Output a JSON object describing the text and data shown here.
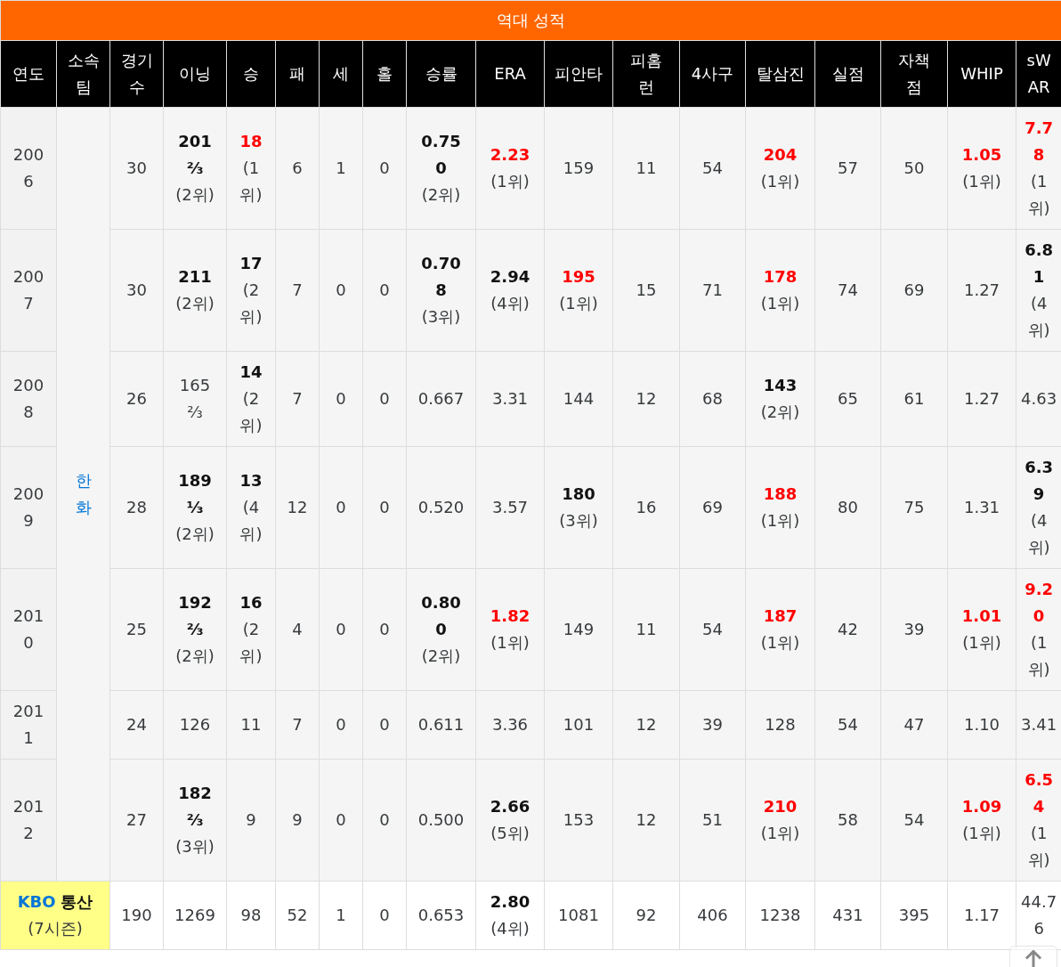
{
  "title": "역대 성적",
  "columns": [
    "연도",
    "소속팀",
    "경기수",
    "이닝",
    "승",
    "패",
    "세",
    "홀",
    "승률",
    "ERA",
    "피안타",
    "피홈런",
    "4사구",
    "탈삼진",
    "실점",
    "자책점",
    "WHIP",
    "sWAR"
  ],
  "team": "한화",
  "rows": [
    {
      "year": "2006",
      "cells": [
        {
          "value": "30",
          "kind": "plain"
        },
        {
          "value": "201⅔",
          "rank": "(2위)",
          "kind": "bold"
        },
        {
          "value": "18",
          "rank": "(1위)",
          "kind": "red"
        },
        {
          "value": "6",
          "kind": "plain"
        },
        {
          "value": "1",
          "kind": "plain"
        },
        {
          "value": "0",
          "kind": "plain"
        },
        {
          "value": "0.750",
          "rank": "(2위)",
          "kind": "bold"
        },
        {
          "value": "2.23",
          "rank": "(1위)",
          "kind": "red"
        },
        {
          "value": "159",
          "kind": "plain"
        },
        {
          "value": "11",
          "kind": "plain"
        },
        {
          "value": "54",
          "kind": "plain"
        },
        {
          "value": "204",
          "rank": "(1위)",
          "kind": "red"
        },
        {
          "value": "57",
          "kind": "plain"
        },
        {
          "value": "50",
          "kind": "plain"
        },
        {
          "value": "1.05",
          "rank": "(1위)",
          "kind": "red"
        },
        {
          "value": "7.78",
          "rank": "(1위)",
          "kind": "red"
        }
      ]
    },
    {
      "year": "2007",
      "cells": [
        {
          "value": "30",
          "kind": "plain"
        },
        {
          "value": "211",
          "rank": "(2위)",
          "kind": "bold"
        },
        {
          "value": "17",
          "rank": "(2위)",
          "kind": "bold"
        },
        {
          "value": "7",
          "kind": "plain"
        },
        {
          "value": "0",
          "kind": "plain"
        },
        {
          "value": "0",
          "kind": "plain"
        },
        {
          "value": "0.708",
          "rank": "(3위)",
          "kind": "bold"
        },
        {
          "value": "2.94",
          "rank": "(4위)",
          "kind": "bold"
        },
        {
          "value": "195",
          "rank": "(1위)",
          "kind": "red"
        },
        {
          "value": "15",
          "kind": "plain"
        },
        {
          "value": "71",
          "kind": "plain"
        },
        {
          "value": "178",
          "rank": "(1위)",
          "kind": "red"
        },
        {
          "value": "74",
          "kind": "plain"
        },
        {
          "value": "69",
          "kind": "plain"
        },
        {
          "value": "1.27",
          "kind": "plain"
        },
        {
          "value": "6.81",
          "rank": "(4위)",
          "kind": "bold"
        }
      ]
    },
    {
      "year": "2008",
      "cells": [
        {
          "value": "26",
          "kind": "plain"
        },
        {
          "value": "165⅔",
          "kind": "plain"
        },
        {
          "value": "14",
          "rank": "(2위)",
          "kind": "bold"
        },
        {
          "value": "7",
          "kind": "plain"
        },
        {
          "value": "0",
          "kind": "plain"
        },
        {
          "value": "0",
          "kind": "plain"
        },
        {
          "value": "0.667",
          "kind": "plain"
        },
        {
          "value": "3.31",
          "kind": "plain"
        },
        {
          "value": "144",
          "kind": "plain"
        },
        {
          "value": "12",
          "kind": "plain"
        },
        {
          "value": "68",
          "kind": "plain"
        },
        {
          "value": "143",
          "rank": "(2위)",
          "kind": "bold"
        },
        {
          "value": "65",
          "kind": "plain"
        },
        {
          "value": "61",
          "kind": "plain"
        },
        {
          "value": "1.27",
          "kind": "plain"
        },
        {
          "value": "4.63",
          "kind": "plain"
        }
      ]
    },
    {
      "year": "2009",
      "cells": [
        {
          "value": "28",
          "kind": "plain"
        },
        {
          "value": "189⅓",
          "rank": "(2위)",
          "kind": "bold"
        },
        {
          "value": "13",
          "rank": "(4위)",
          "kind": "bold"
        },
        {
          "value": "12",
          "kind": "plain"
        },
        {
          "value": "0",
          "kind": "plain"
        },
        {
          "value": "0",
          "kind": "plain"
        },
        {
          "value": "0.520",
          "kind": "plain"
        },
        {
          "value": "3.57",
          "kind": "plain"
        },
        {
          "value": "180",
          "rank": "(3위)",
          "kind": "bold"
        },
        {
          "value": "16",
          "kind": "plain"
        },
        {
          "value": "69",
          "kind": "plain"
        },
        {
          "value": "188",
          "rank": "(1위)",
          "kind": "red"
        },
        {
          "value": "80",
          "kind": "plain"
        },
        {
          "value": "75",
          "kind": "plain"
        },
        {
          "value": "1.31",
          "kind": "plain"
        },
        {
          "value": "6.39",
          "rank": "(4위)",
          "kind": "bold"
        }
      ]
    },
    {
      "year": "2010",
      "cells": [
        {
          "value": "25",
          "kind": "plain"
        },
        {
          "value": "192⅔",
          "rank": "(2위)",
          "kind": "bold"
        },
        {
          "value": "16",
          "rank": "(2위)",
          "kind": "bold"
        },
        {
          "value": "4",
          "kind": "plain"
        },
        {
          "value": "0",
          "kind": "plain"
        },
        {
          "value": "0",
          "kind": "plain"
        },
        {
          "value": "0.800",
          "rank": "(2위)",
          "kind": "bold"
        },
        {
          "value": "1.82",
          "rank": "(1위)",
          "kind": "red"
        },
        {
          "value": "149",
          "kind": "plain"
        },
        {
          "value": "11",
          "kind": "plain"
        },
        {
          "value": "54",
          "kind": "plain"
        },
        {
          "value": "187",
          "rank": "(1위)",
          "kind": "red"
        },
        {
          "value": "42",
          "kind": "plain"
        },
        {
          "value": "39",
          "kind": "plain"
        },
        {
          "value": "1.01",
          "rank": "(1위)",
          "kind": "red"
        },
        {
          "value": "9.20",
          "rank": "(1위)",
          "kind": "red"
        }
      ]
    },
    {
      "year": "2011",
      "cells": [
        {
          "value": "24",
          "kind": "plain"
        },
        {
          "value": "126",
          "kind": "plain"
        },
        {
          "value": "11",
          "kind": "plain"
        },
        {
          "value": "7",
          "kind": "plain"
        },
        {
          "value": "0",
          "kind": "plain"
        },
        {
          "value": "0",
          "kind": "plain"
        },
        {
          "value": "0.611",
          "kind": "plain"
        },
        {
          "value": "3.36",
          "kind": "plain"
        },
        {
          "value": "101",
          "kind": "plain"
        },
        {
          "value": "12",
          "kind": "plain"
        },
        {
          "value": "39",
          "kind": "plain"
        },
        {
          "value": "128",
          "kind": "plain"
        },
        {
          "value": "54",
          "kind": "plain"
        },
        {
          "value": "47",
          "kind": "plain"
        },
        {
          "value": "1.10",
          "kind": "plain"
        },
        {
          "value": "3.41",
          "kind": "plain"
        }
      ]
    },
    {
      "year": "2012",
      "cells": [
        {
          "value": "27",
          "kind": "plain"
        },
        {
          "value": "182⅔",
          "rank": "(3위)",
          "kind": "bold"
        },
        {
          "value": "9",
          "kind": "plain"
        },
        {
          "value": "9",
          "kind": "plain"
        },
        {
          "value": "0",
          "kind": "plain"
        },
        {
          "value": "0",
          "kind": "plain"
        },
        {
          "value": "0.500",
          "kind": "plain"
        },
        {
          "value": "2.66",
          "rank": "(5위)",
          "kind": "bold"
        },
        {
          "value": "153",
          "kind": "plain"
        },
        {
          "value": "12",
          "kind": "plain"
        },
        {
          "value": "51",
          "kind": "plain"
        },
        {
          "value": "210",
          "rank": "(1위)",
          "kind": "red"
        },
        {
          "value": "58",
          "kind": "plain"
        },
        {
          "value": "54",
          "kind": "plain"
        },
        {
          "value": "1.09",
          "rank": "(1위)",
          "kind": "red"
        },
        {
          "value": "6.54",
          "rank": "(1위)",
          "kind": "red"
        }
      ]
    }
  ],
  "total": {
    "league": "KBO",
    "label": "통산",
    "seasons": "(7시즌)",
    "cells": [
      {
        "value": "190",
        "kind": "plain"
      },
      {
        "value": "1269",
        "kind": "plain"
      },
      {
        "value": "98",
        "kind": "plain"
      },
      {
        "value": "52",
        "kind": "plain"
      },
      {
        "value": "1",
        "kind": "plain"
      },
      {
        "value": "0",
        "kind": "plain"
      },
      {
        "value": "0.653",
        "kind": "plain"
      },
      {
        "value": "2.80",
        "rank": "(4위)",
        "kind": "bold"
      },
      {
        "value": "1081",
        "kind": "plain"
      },
      {
        "value": "92",
        "kind": "plain"
      },
      {
        "value": "406",
        "kind": "plain"
      },
      {
        "value": "1238",
        "kind": "plain"
      },
      {
        "value": "431",
        "kind": "plain"
      },
      {
        "value": "395",
        "kind": "plain"
      },
      {
        "value": "1.17",
        "kind": "plain"
      },
      {
        "value": "44.76",
        "kind": "plain"
      }
    ]
  }
}
